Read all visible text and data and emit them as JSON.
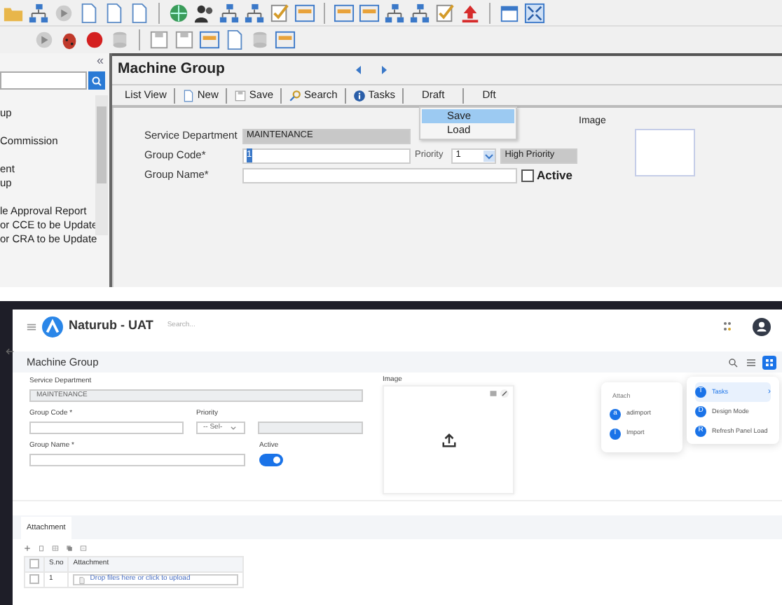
{
  "legacy": {
    "sidebar": {
      "collapse": "«",
      "items": [
        "up",
        "Commission",
        "ent",
        "up",
        "le Approval Report",
        "or CCE to be Update",
        "or CRA to be Update"
      ]
    },
    "title": "Machine Group",
    "toolbar": [
      "List View",
      "New",
      "Save",
      "Search",
      "Tasks",
      "Draft",
      "Dft"
    ],
    "draft_menu": [
      {
        "label": "Save",
        "selected": true
      },
      {
        "label": "Load",
        "selected": false
      }
    ],
    "form": {
      "service_department": {
        "label": "Service Department",
        "value": "MAINTENANCE"
      },
      "group_code": {
        "label": "Group Code*",
        "value": "1"
      },
      "priority": {
        "label": "Priority",
        "value": "1",
        "description": "High Priority"
      },
      "group_name": {
        "label": "Group Name*"
      },
      "active": {
        "label": "Active",
        "checked": false
      },
      "image": {
        "label": "Image"
      }
    }
  },
  "web": {
    "app_title": "Naturub - UAT",
    "search": {
      "placeholder": "Search..."
    },
    "page_title": "Machine Group",
    "form": {
      "service_department": {
        "label": "Service Department",
        "value": "MAINTENANCE"
      },
      "group_code": {
        "label": "Group Code *"
      },
      "priority": {
        "label": "Priority",
        "value": "-- Sel-"
      },
      "group_name": {
        "label": "Group Name *"
      },
      "active": {
        "label": "Active",
        "on": true
      },
      "image": {
        "label": "Image"
      }
    },
    "attach_menu": {
      "title": "Attach",
      "items": [
        {
          "badge": "a",
          "label": "adimport"
        },
        {
          "badge": "I",
          "label": "Import"
        }
      ]
    },
    "task_menu": [
      {
        "badge": "T",
        "label": "Tasks",
        "chevron": "›",
        "selected": true
      },
      {
        "badge": "D",
        "label": "Design Mode",
        "selected": false
      },
      {
        "badge": "R",
        "label": "Refresh Panel Load",
        "selected": false
      }
    ],
    "tabs": [
      {
        "label": "Attachment",
        "selected": true
      }
    ],
    "table": {
      "columns": [
        "S.no",
        "Attachment"
      ],
      "header_checked": false,
      "rows": [
        {
          "checked": false,
          "cells": [
            "1",
            "Drop files here or click to upload"
          ]
        }
      ]
    }
  }
}
